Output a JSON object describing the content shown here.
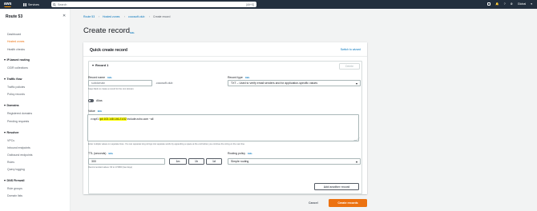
{
  "topnav": {
    "logo": "aws",
    "services": "Services",
    "search_placeholder": "Search",
    "search_shortcut": "[Alt+S]",
    "region": "Global",
    "account": "▾"
  },
  "sidebar": {
    "title": "Route 53",
    "items": [
      {
        "label": "Dashboard"
      },
      {
        "label": "Hosted zones",
        "active": true
      },
      {
        "label": "Health checks"
      }
    ],
    "sections": [
      {
        "title": "IP-based routing",
        "items": [
          "CIDR collections"
        ]
      },
      {
        "title": "Traffic flow",
        "items": [
          "Traffic policies",
          "Policy records"
        ]
      },
      {
        "title": "Domains",
        "items": [
          "Registered domains",
          "Pending requests"
        ]
      },
      {
        "title": "Resolver",
        "items": [
          "VPCs",
          "Inbound endpoints",
          "Outbound endpoints",
          "Rules",
          "Query logging"
        ]
      },
      {
        "title": "DNS Firewall",
        "items": [
          "Rule groups",
          "Domain lists"
        ]
      }
    ]
  },
  "breadcrumb": [
    "Route 53",
    "Hosted zones",
    "cocosoft.club",
    "Create record"
  ],
  "page": {
    "title": "Create record",
    "info": "Info"
  },
  "panel": {
    "title": "Quick create record",
    "switch_link": "Switch to wizard",
    "record": {
      "heading": "Record 1",
      "delete": "Delete",
      "record_name_label": "Record name",
      "record_name_placeholder": "subdomain",
      "domain_suffix": ".cocosoft.club",
      "record_name_hint": "Keep blank to create a record for the root domain.",
      "record_type_label": "Record type",
      "record_type_value": "TXT – Used to verify email senders and for application-specific values",
      "alias_label": "Alias",
      "value_label": "Value",
      "value_prefix": "v=spf1 ",
      "value_highlight": "ip4:103.148.146.21/32",
      "value_suffix": " include:zoho.com ~all",
      "value_hint": "Enter multiple values on separate lines. You can separate long strings into separate words by appending a space at the end before you continue the string on the next line.",
      "ttl_label": "TTL (seconds)",
      "ttl_value": "300",
      "ttl_buttons": [
        "1m",
        "1h",
        "1d"
      ],
      "ttl_hint": "Recommended values: 60 to 172800 (two days)",
      "routing_label": "Routing policy",
      "routing_value": "Simple routing"
    },
    "add_another": "Add another record"
  },
  "footer": {
    "cancel": "Cancel",
    "create": "Create records"
  }
}
